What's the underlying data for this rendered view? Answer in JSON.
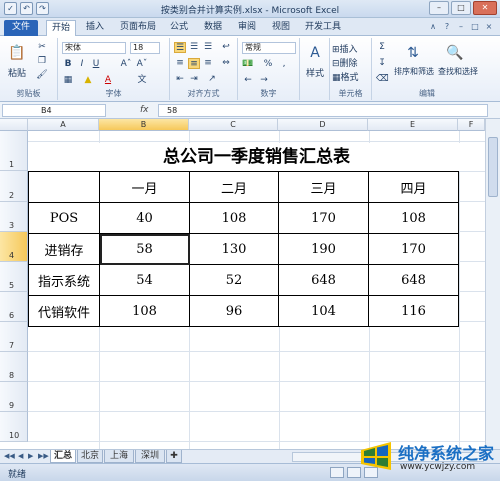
{
  "window": {
    "title": "按类别合并计算实例.xlsx - Microsoft Excel",
    "qat": [
      "✓",
      "↶",
      "↷"
    ],
    "controls": [
      "–",
      "□",
      "✕"
    ]
  },
  "ribbon_tabs": [
    "文件",
    "开始",
    "插入",
    "页面布局",
    "公式",
    "数据",
    "审阅",
    "视图",
    "开发工具"
  ],
  "active_tab": "开始",
  "ribbon": {
    "clipboard": {
      "paste": "粘贴",
      "label": "剪贴板"
    },
    "font": {
      "name": "宋体",
      "size": "18",
      "bold": "B",
      "italic": "I",
      "underline": "U",
      "grow": "Aˆ",
      "shrink": "Aˇ",
      "label": "字体"
    },
    "alignment": {
      "label": "对齐方式"
    },
    "number": {
      "format": "常规",
      "percent": "%",
      "comma": ",",
      "label": "数字"
    },
    "styles": {
      "text": "样式"
    },
    "cells": {
      "insert": "插入",
      "delete": "删除",
      "format": "格式",
      "label": "单元格"
    },
    "editing": {
      "sigma": "Σ",
      "sort": "排序和筛选",
      "find": "查找和选择",
      "label": "编辑"
    }
  },
  "formula_bar": {
    "cell_ref": "B4",
    "fx": "fx",
    "value": "58"
  },
  "columns": [
    "A",
    "B",
    "C",
    "D",
    "E",
    "F"
  ],
  "rows": [
    "1",
    "2",
    "3",
    "4",
    "5",
    "6",
    "7",
    "8",
    "9",
    "10"
  ],
  "sheet": {
    "title": "总公司一季度销售汇总表",
    "header": [
      "",
      "一月",
      "二月",
      "三月",
      "四月"
    ],
    "data": [
      [
        "POS",
        "40",
        "108",
        "170",
        "108"
      ],
      [
        "进销存",
        "58",
        "130",
        "190",
        "170"
      ],
      [
        "指示系统",
        "54",
        "52",
        "648",
        "648"
      ],
      [
        "代销软件",
        "108",
        "96",
        "104",
        "116"
      ]
    ]
  },
  "sheet_tabs": [
    "汇总",
    "北京",
    "上海",
    "深圳"
  ],
  "active_sheet": "汇总",
  "status": {
    "ready": "就绪"
  },
  "watermark": {
    "name": "纯净系统之家",
    "url": "www.ycwjzy.com"
  }
}
